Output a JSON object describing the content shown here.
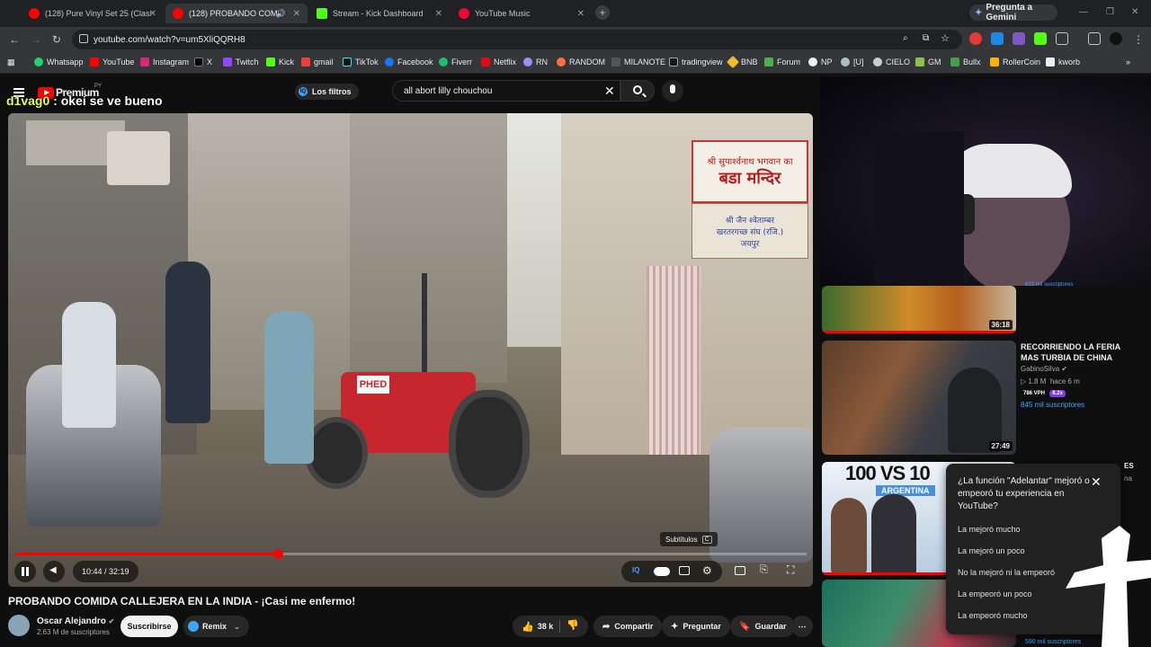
{
  "browser": {
    "tabs": [
      {
        "title": "(128) Pure Vinyl Set 25 (Classic",
        "favicon": "youtube-icon"
      },
      {
        "title": "(128) PROBANDO COMIDA",
        "favicon": "youtube-icon",
        "active": true
      },
      {
        "title": "Stream - Kick Dashboard",
        "favicon": "kick-icon"
      },
      {
        "title": "YouTube Music",
        "favicon": "youtube-music-icon"
      }
    ],
    "gemini_button": "Pregunta a Gemini",
    "url": "youtube.com/watch?v=um5XliQQRH8",
    "bookmarks": [
      "Whatsapp",
      "YouTube",
      "Instagram",
      "X",
      "Twitch",
      "Kick",
      "gmail",
      "TikTok",
      "Facebook",
      "Fiverr",
      "Netflix",
      "RN",
      "RANDOM",
      "MILANOTE",
      "tradingview",
      "BNB",
      "Forum",
      "NP",
      "[U]",
      "CIELO",
      "GM",
      "Bullx",
      "RollerCoin",
      "kworb"
    ]
  },
  "youtube": {
    "logo_text": "Premium",
    "region": "PY",
    "filters_chip": "Los filtros",
    "search_value": "all abort lilly chouchou",
    "chat_overlay": {
      "user": "d1vag0",
      "message": " : okei se ve bueno"
    },
    "player": {
      "time": "10:44 / 32:19",
      "progress": 0.332,
      "subtitles_tooltip": "Subtítulos",
      "subtitles_key": "C",
      "shop_signs": [
        "श्री सुपार्श्वनाथ भगवान का",
        "बडा मन्दिर",
        "श्री जैन श्वेताम्बर",
        "खरतरगच्छ संघ (रजि.)",
        "जयपुर"
      ],
      "tractor_plate": "PHED"
    },
    "video_title": "PROBANDO COMIDA CALLEJERA EN LA INDIA - ¡Casi me enfermo!",
    "channel": {
      "name": "Oscar Alejandro",
      "subs": "2.63 M de suscriptores"
    },
    "subscribe_label": "Suscribirse",
    "remix_label": "Remix",
    "actions": {
      "likes": "38 k",
      "share": "Compartir",
      "ask": "Preguntar",
      "save": "Guardar"
    },
    "recommendations": [
      {
        "duration": "36:18",
        "partial_meta": "613 mil suscriptores"
      },
      {
        "duration": "27:49",
        "title": "RECORRIENDO LA FERIA MAS TURBIA DE CHINA",
        "channel": "GabinoSilva",
        "views": "1.8 M",
        "age": "hace 6 m",
        "vph": "786 VPH",
        "multiplier": "8.2x",
        "subs": "845 mil suscriptores"
      },
      {
        "thumb_text": "100 VS 10",
        "thumb_subtext": "ARGENTINA",
        "partial_title": "ES",
        "partial_channel": "na"
      },
      {
        "partial_meta": "590 mil suscriptores"
      }
    ],
    "survey": {
      "question": "¿La función \"Adelantar\" mejoró o empeoró tu experiencia en YouTube?",
      "options": [
        "La mejoró mucho",
        "La mejoró un poco",
        "No la mejoró ni la empeoró",
        "La empeoró un poco",
        "La empeoró mucho"
      ]
    }
  },
  "colors": {
    "accent": "#ff0000",
    "kick": "#53fc18",
    "vph": "#3ea6ff",
    "multiplier": "#7c3aed"
  }
}
